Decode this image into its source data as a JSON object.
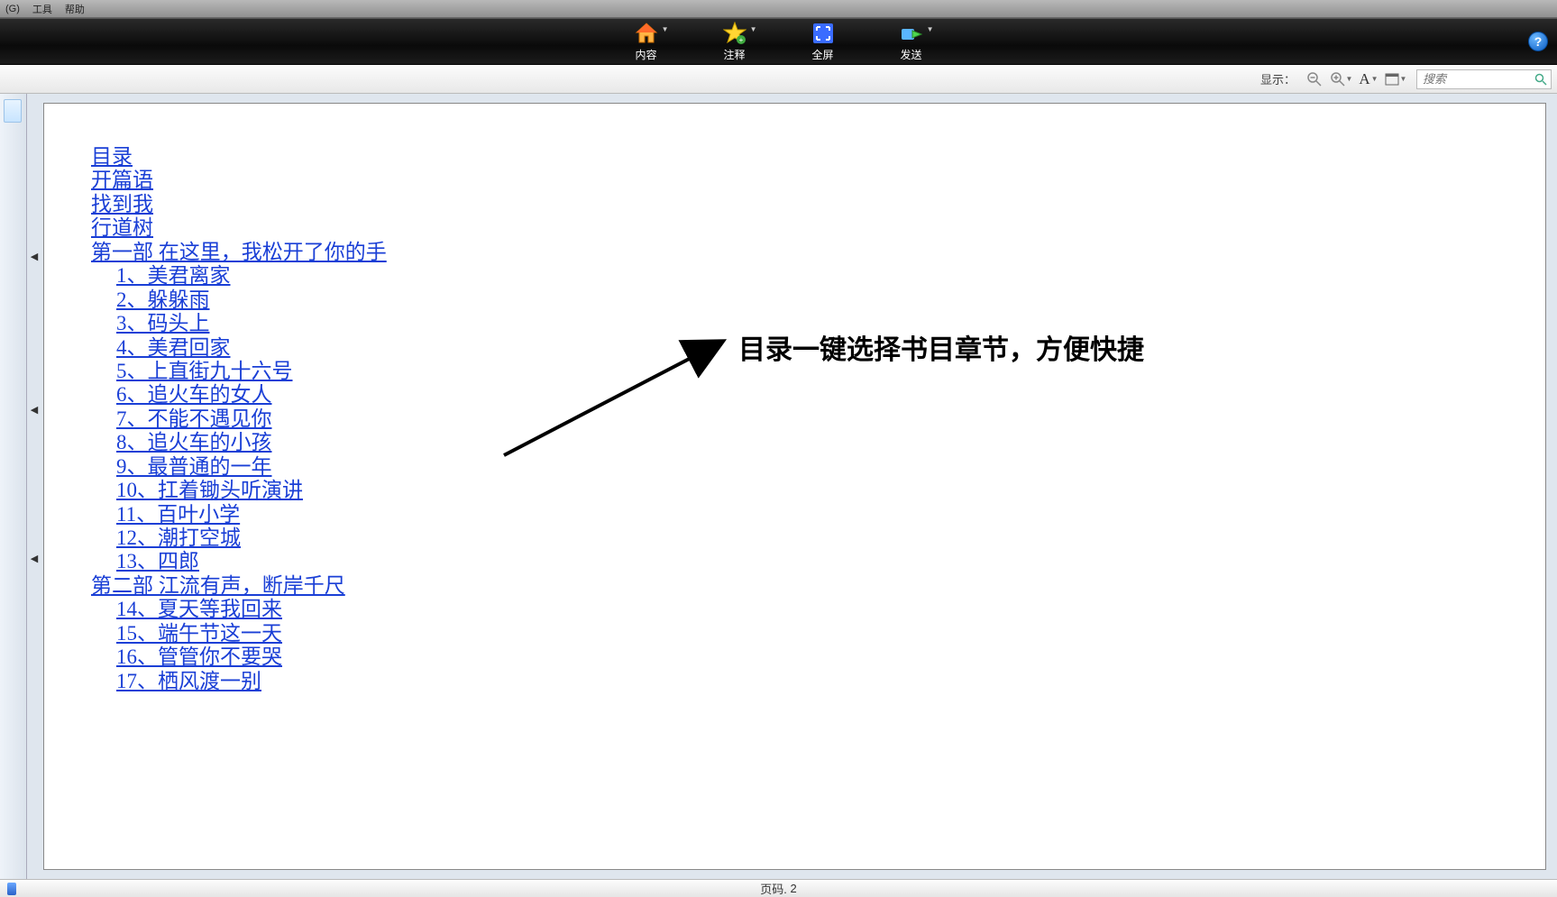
{
  "menubar": {
    "items": [
      "(G)",
      "工具",
      "帮助"
    ]
  },
  "toolbar": {
    "items": [
      {
        "label": "内容",
        "icon": "home-icon"
      },
      {
        "label": "注释",
        "icon": "star-icon"
      },
      {
        "label": "全屏",
        "icon": "fullscreen-icon"
      },
      {
        "label": "发送",
        "icon": "send-icon"
      }
    ],
    "help_tooltip": "?"
  },
  "subbar": {
    "label": "显示：",
    "search_placeholder": "搜索"
  },
  "toc": {
    "entries": [
      {
        "text": "目录",
        "level": 0
      },
      {
        "text": "开篇语",
        "level": 0
      },
      {
        "text": "找到我",
        "level": 0
      },
      {
        "text": "行道树",
        "level": 0
      },
      {
        "text": "第一部  在这里，我松开了你的手",
        "level": 0
      },
      {
        "text": "1、美君离家",
        "level": 1
      },
      {
        "text": "2、躲躲雨",
        "level": 1
      },
      {
        "text": "3、码头上",
        "level": 1
      },
      {
        "text": "4、美君回家",
        "level": 1
      },
      {
        "text": "5、上直街九十六号",
        "level": 1
      },
      {
        "text": "6、追火车的女人",
        "level": 1
      },
      {
        "text": "7、不能不遇见你",
        "level": 1
      },
      {
        "text": "8、追火车的小孩",
        "level": 1
      },
      {
        "text": "9、最普通的一年",
        "level": 1
      },
      {
        "text": "10、扛着锄头听演讲",
        "level": 1
      },
      {
        "text": "11、百叶小学",
        "level": 1
      },
      {
        "text": "12、潮打空城",
        "level": 1
      },
      {
        "text": "13、四郎",
        "level": 1
      },
      {
        "text": "第二部  江流有声，断岸千尺",
        "level": 0
      },
      {
        "text": "14、夏天等我回来",
        "level": 1
      },
      {
        "text": "15、端午节这一天",
        "level": 1
      },
      {
        "text": "16、管管你不要哭",
        "level": 1
      },
      {
        "text": "17、栖风渡一别",
        "level": 1
      }
    ]
  },
  "annotation": "目录一键选择书目章节，方便快捷",
  "status": {
    "page_label": "页码.",
    "page_num": "2"
  }
}
